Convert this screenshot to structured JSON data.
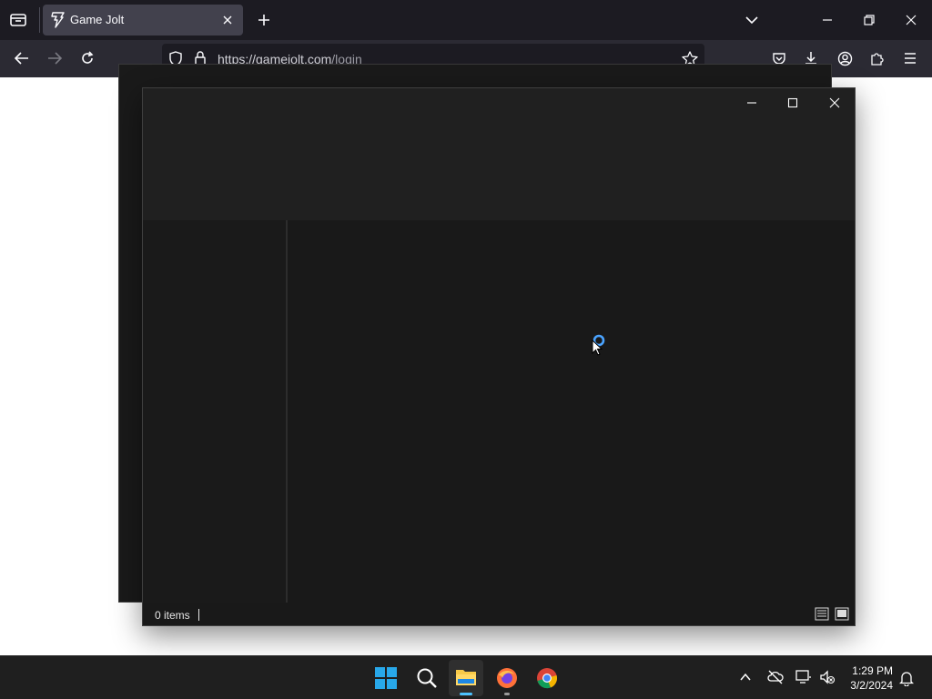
{
  "browser": {
    "tab_title": "Game Jolt",
    "url_domain": "https://gamejolt.com",
    "url_path": "/login"
  },
  "explorer": {
    "status_items": "0 items"
  },
  "taskbar": {
    "time": "1:29 PM",
    "date": "3/2/2024"
  },
  "colors": {
    "accent": "#0078d4",
    "spinner": "#4aa3ff"
  }
}
